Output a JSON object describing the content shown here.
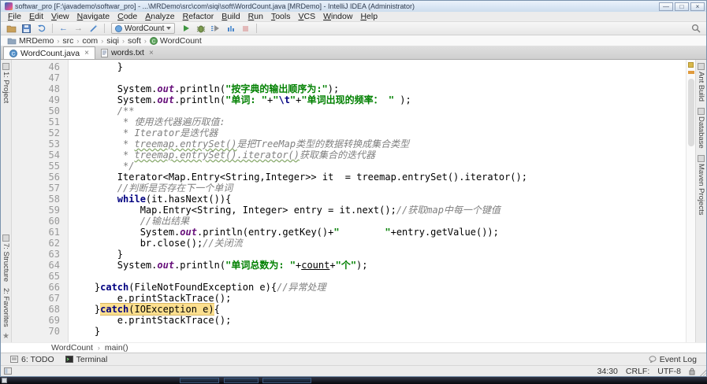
{
  "window": {
    "title": "softwar_pro [F:\\javademo\\softwar_pro] - ...\\MRDemo\\src\\com\\siqi\\soft\\WordCount.java [MRDemo] - IntelliJ IDEA (Administrator)",
    "minimize": "—",
    "maximize": "□",
    "close": "×"
  },
  "menu": {
    "items": [
      "File",
      "Edit",
      "View",
      "Navigate",
      "Code",
      "Analyze",
      "Refactor",
      "Build",
      "Run",
      "Tools",
      "VCS",
      "Window",
      "Help"
    ]
  },
  "toolbar": {
    "run_config": "WordCount",
    "icons": [
      "open-icon",
      "save-all-icon",
      "synchronize-icon",
      "back-icon",
      "forward-icon",
      "wand-icon",
      "run-icon",
      "debug-icon",
      "coverage-icon",
      "profiler-icon",
      "stop-icon",
      "search-icon"
    ],
    "back_glyph": "←",
    "forward_glyph": "→"
  },
  "navbar": {
    "separator": "›",
    "items": [
      "MRDemo",
      "src",
      "com",
      "siqi",
      "soft",
      "WordCount"
    ]
  },
  "tabs": [
    {
      "label": "WordCount.java",
      "close": "×"
    },
    {
      "label": "words.txt",
      "close": "×"
    }
  ],
  "left_strip": [
    {
      "label": "1: Project"
    },
    {
      "label": "7: Structure"
    },
    {
      "label": "2: Favorites"
    }
  ],
  "right_strip": [
    {
      "label": "Ant Build"
    },
    {
      "label": "Database"
    },
    {
      "label": "Maven Projects"
    }
  ],
  "editor": {
    "lines": [
      {
        "num": 46,
        "tokens": [
          {
            "t": "        }",
            "c": "p"
          }
        ]
      },
      {
        "num": 47,
        "tokens": []
      },
      {
        "num": 48,
        "tokens": [
          {
            "t": "        System.",
            "c": "p"
          },
          {
            "t": "out",
            "c": "f"
          },
          {
            "t": ".println(",
            "c": "p"
          },
          {
            "t": "\"按字典的输出顺序为:\"",
            "c": "s"
          },
          {
            "t": ");",
            "c": "p"
          }
        ]
      },
      {
        "num": 49,
        "tokens": [
          {
            "t": "        System.",
            "c": "p"
          },
          {
            "t": "out",
            "c": "f"
          },
          {
            "t": ".println(",
            "c": "p"
          },
          {
            "t": "\"单词: \"",
            "c": "s"
          },
          {
            "t": "+",
            "c": "p"
          },
          {
            "t": "\"",
            "c": "s"
          },
          {
            "t": "\\t",
            "c": "e"
          },
          {
            "t": "\"",
            "c": "s"
          },
          {
            "t": "+",
            "c": "p"
          },
          {
            "t": "\"单词出现的频率： \"",
            "c": "s"
          },
          {
            "t": " );",
            "c": "p"
          }
        ]
      },
      {
        "num": 50,
        "tokens": [
          {
            "t": "        /**",
            "c": "c"
          }
        ]
      },
      {
        "num": 51,
        "tokens": [
          {
            "t": "         * 使用迭代器遍历取值:",
            "c": "c"
          }
        ]
      },
      {
        "num": 52,
        "tokens": [
          {
            "t": "         * Iterator是迭代器",
            "c": "c"
          }
        ]
      },
      {
        "num": 53,
        "tokens": [
          {
            "t": "         * ",
            "c": "c"
          },
          {
            "t": "treemap.entrySet()",
            "c": "cu"
          },
          {
            "t": "是把TreeMap类型的数据转换成集合类型",
            "c": "c"
          }
        ]
      },
      {
        "num": 54,
        "tokens": [
          {
            "t": "         * ",
            "c": "c"
          },
          {
            "t": "treemap.entrySet().iterator()",
            "c": "cu"
          },
          {
            "t": "获取集合的迭代器",
            "c": "c"
          }
        ]
      },
      {
        "num": 55,
        "tokens": [
          {
            "t": "         */",
            "c": "c"
          }
        ]
      },
      {
        "num": 56,
        "tokens": [
          {
            "t": "        Iterator<Map.Entry<String,Integer>> it  = treemap.entrySet().iterator();",
            "c": "p"
          }
        ]
      },
      {
        "num": 57,
        "tokens": [
          {
            "t": "        ",
            "c": "p"
          },
          {
            "t": "//判断是否存在下一个单词",
            "c": "c"
          }
        ]
      },
      {
        "num": 58,
        "tokens": [
          {
            "t": "        ",
            "c": "p"
          },
          {
            "t": "while",
            "c": "k"
          },
          {
            "t": "(it.hasNext()){",
            "c": "p"
          }
        ]
      },
      {
        "num": 59,
        "tokens": [
          {
            "t": "            Map.Entry<String, Integer> entry = it.next();",
            "c": "p"
          },
          {
            "t": "//获取map中每一个键值",
            "c": "c"
          }
        ]
      },
      {
        "num": 60,
        "tokens": [
          {
            "t": "            ",
            "c": "p"
          },
          {
            "t": "//输出结果",
            "c": "c"
          }
        ]
      },
      {
        "num": 61,
        "tokens": [
          {
            "t": "            System.",
            "c": "p"
          },
          {
            "t": "out",
            "c": "f"
          },
          {
            "t": ".println(entry.getKey()+",
            "c": "p"
          },
          {
            "t": "\"        \"",
            "c": "s"
          },
          {
            "t": "+entry.getValue());",
            "c": "p"
          }
        ]
      },
      {
        "num": 62,
        "tokens": [
          {
            "t": "            br.close();",
            "c": "p"
          },
          {
            "t": "//关闭流",
            "c": "c"
          }
        ]
      },
      {
        "num": 63,
        "tokens": [
          {
            "t": "        }",
            "c": "p"
          }
        ]
      },
      {
        "num": 64,
        "tokens": [
          {
            "t": "        System.",
            "c": "p"
          },
          {
            "t": "out",
            "c": "f"
          },
          {
            "t": ".println(",
            "c": "p"
          },
          {
            "t": "\"单词总数为: \"",
            "c": "s"
          },
          {
            "t": "+",
            "c": "p"
          },
          {
            "t": "count",
            "c": "u"
          },
          {
            "t": "+",
            "c": "p"
          },
          {
            "t": "\"个\"",
            "c": "s"
          },
          {
            "t": ");",
            "c": "p"
          }
        ]
      },
      {
        "num": 65,
        "tokens": []
      },
      {
        "num": 66,
        "tokens": [
          {
            "t": "    }",
            "c": "p"
          },
          {
            "t": "catch",
            "c": "k"
          },
          {
            "t": "(FileNotFoundException e){",
            "c": "p"
          },
          {
            "t": "//异常处理",
            "c": "c"
          }
        ]
      },
      {
        "num": 67,
        "tokens": [
          {
            "t": "        e.printStackTrace();",
            "c": "p"
          }
        ]
      },
      {
        "num": 68,
        "tokens": [
          {
            "t": "    }",
            "c": "p"
          },
          {
            "t": "catch",
            "c": "k hl"
          },
          {
            "t": "(IOException e)",
            "c": "p hl"
          },
          {
            "t": "{",
            "c": "p"
          }
        ]
      },
      {
        "num": 69,
        "tokens": [
          {
            "t": "        e.printStackTrace();",
            "c": "p"
          }
        ]
      },
      {
        "num": 70,
        "tokens": [
          {
            "t": "    }",
            "c": "p"
          }
        ]
      }
    ]
  },
  "bottom_crumbs": {
    "separator": "›",
    "items": [
      "WordCount",
      "main()"
    ]
  },
  "toolwindow_bar": {
    "todo": "6: TODO",
    "terminal": "Terminal",
    "event_log": "Event Log"
  },
  "status_bar": {
    "position": "34:30",
    "line_separator": "CRLF:",
    "encoding": "UTF-8"
  },
  "colors": {
    "keyword": "#000080",
    "string": "#008000",
    "comment": "#808080",
    "field": "#660E7A",
    "usage_highlight": "#fcdf8e",
    "run_green": "#3f9642"
  }
}
